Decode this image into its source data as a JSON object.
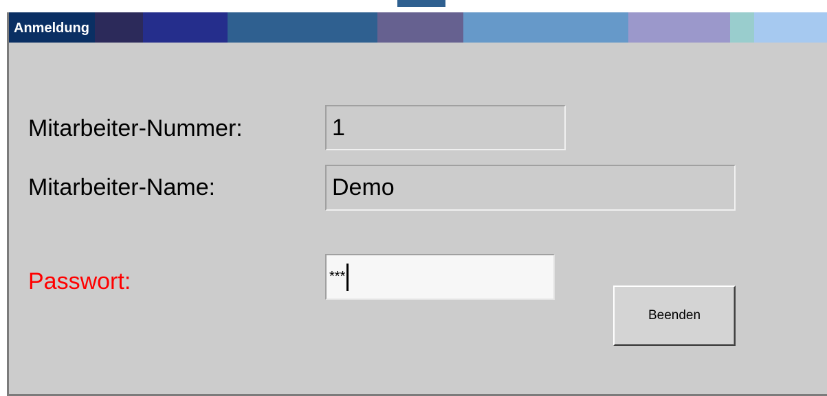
{
  "window": {
    "title": "Anmeldung",
    "titlebar_colors": [
      "#0a2f63",
      "#2c2a5a",
      "#252e8c",
      "#2f6090",
      "#666190",
      "#6699c9",
      "#9b98cb",
      "#99cdcd",
      "#a6c9f0"
    ]
  },
  "form": {
    "employee_number_label": "Mitarbeiter-Nummer:",
    "employee_number_value": "1",
    "employee_name_label": "Mitarbeiter-Name:",
    "employee_name_value": "Demo",
    "password_label": "Passwort:",
    "password_label_color": "#ff0000",
    "password_value": "***"
  },
  "buttons": {
    "quit_label": "Beenden"
  }
}
